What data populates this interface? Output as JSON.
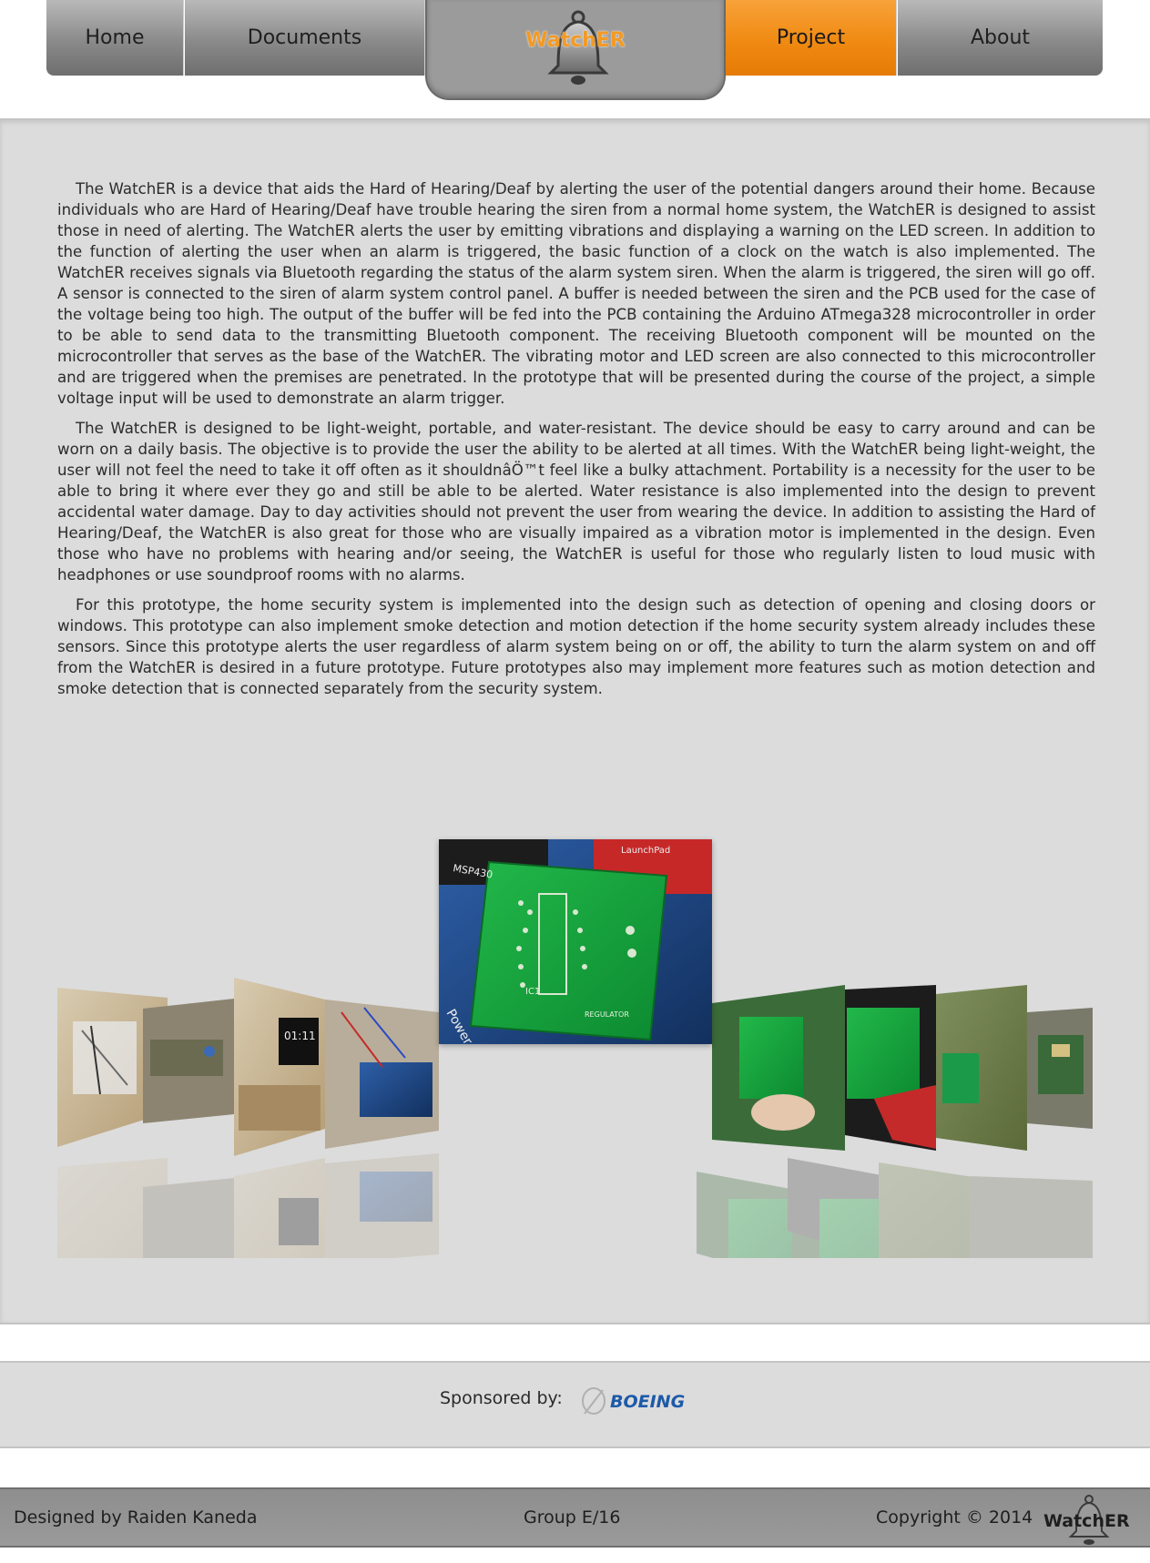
{
  "nav": {
    "home": "Home",
    "documents": "Documents",
    "logo_text": "WatchER",
    "project": "Project",
    "about": "About",
    "active_color": "#f08a12"
  },
  "content": {
    "paragraphs": [
      "The WatchER is a device that aids the Hard of Hearing/Deaf by alerting the user of the potential dangers around their home. Because individuals who are Hard of Hearing/Deaf have trouble hearing the siren from a normal home system, the WatchER is designed to assist those in need of alerting. The WatchER alerts the user by emitting vibrations and displaying a warning on the LED screen. In addition to the function of alerting the user when an alarm is triggered, the basic function of a clock on the watch is also implemented. The WatchER receives signals via Bluetooth regarding the status of the alarm system siren. When the alarm is triggered, the siren will go off. A sensor is connected to the siren of alarm system control panel. A buffer is needed between the siren and the PCB used for the case of the voltage being too high. The output of the buffer will be fed into the PCB containing the Arduino ATmega328 microcontroller in order to be able to send data to the transmitting Bluetooth component. The receiving Bluetooth component will be mounted on the microcontroller that serves as the base of the WatchER. The vibrating motor and LED screen are also connected to this microcontroller and are triggered when the premises are penetrated. In the prototype that will be presented during the course of the project, a simple voltage input will be used to demonstrate an alarm trigger.",
      "The WatchER is designed to be light-weight, portable, and water-resistant. The device should be easy to carry around and can be worn on a daily basis. The objective is to provide the user the ability to be alerted at all times. With the WatchER being light-weight, the user will not feel the need to take it off often as it shouldnâÖ™t feel like a bulky attachment. Portability is a necessity for the user to be able to bring it where ever they go and still be able to be alerted. Water resistance is also implemented into the design to prevent accidental water damage. Day to day activities should not prevent the user from wearing the device. In addition to assisting the Hard of Hearing/Deaf, the WatchER is also great for those who are visually impaired as a vibration motor is implemented in the design. Even those who have no problems with hearing and/or seeing, the WatchER is useful for those who regularly listen to loud music with headphones or use soundproof rooms with no alarms.",
      "For this prototype, the home security system is implemented into the design such as detection of opening and closing doors or windows. This prototype can also implement smoke detection and motion detection if the home security system already includes these sensors. Since this prototype alerts the user regardless of alarm system being on or off, the ability to turn the alarm system on and off from the WatchER is desired in a future prototype. Future prototypes also may implement more features such as motion detection and smoke detection that is connected separately from the security system."
    ]
  },
  "gallery": {
    "center_board_text": [
      "MSP430",
      "IC1",
      "REGULATOR",
      "LaunchPad",
      "Power"
    ]
  },
  "sponsor": {
    "label": "Sponsored by:",
    "brand": "BOEING"
  },
  "footer": {
    "designer": "Designed by Raiden Kaneda",
    "group": "Group E/16",
    "copyright": "Copyright © 2014",
    "logo_text": "WatchER"
  }
}
